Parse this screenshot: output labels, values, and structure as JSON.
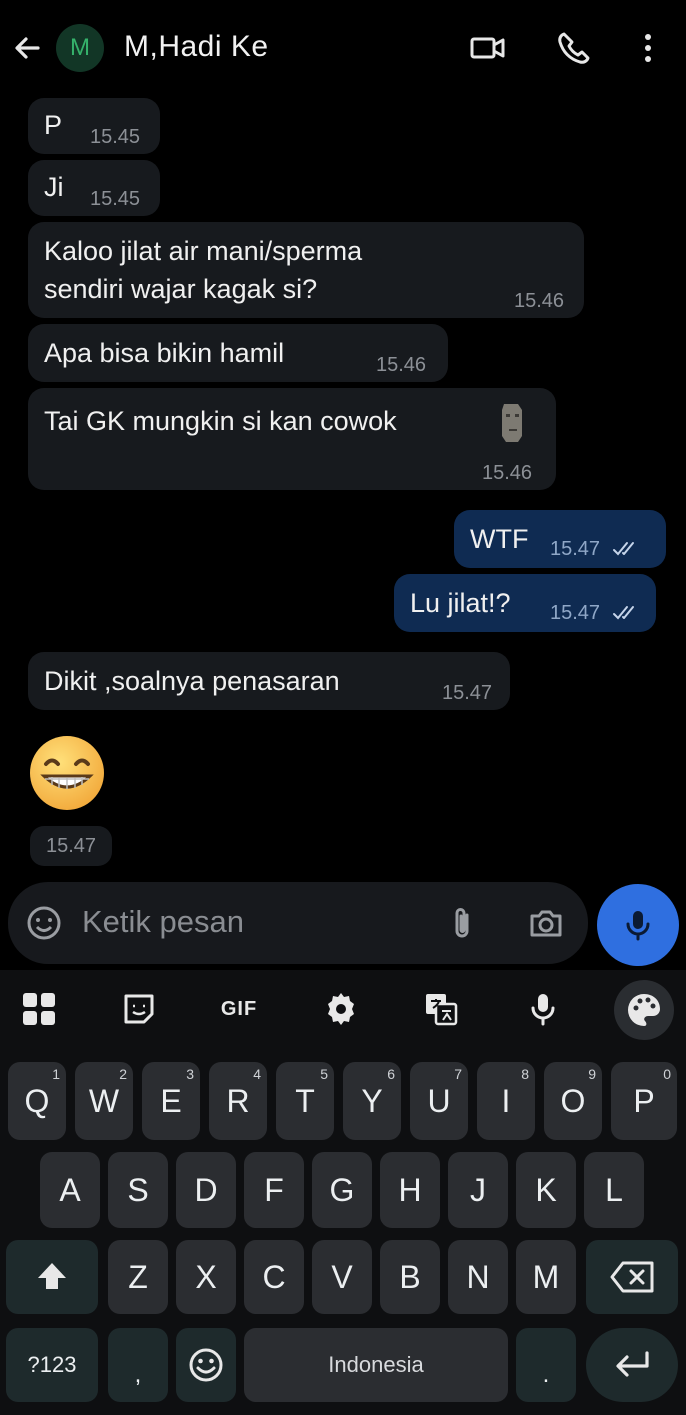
{
  "header": {
    "contact_initial": "M",
    "contact_name": "M,Hadi Ke"
  },
  "messages": [
    {
      "text": "P",
      "time": "15.45"
    },
    {
      "text": "Ji",
      "time": "15.45"
    },
    {
      "text": "Kaloo jilat air mani/sperma\nsendiri wajar kagak si?",
      "time": "15.46"
    },
    {
      "text": "Apa bisa bikin hamil",
      "time": "15.46"
    },
    {
      "text": "Tai GK mungkin si kan cowok",
      "time": "15.46"
    },
    {
      "text": "WTF",
      "time": "15.47"
    },
    {
      "text": "Lu jilat!?",
      "time": "15.47"
    },
    {
      "text": "Dikit ,soalnya penasaran",
      "time": "15.47"
    },
    {
      "time": "15.47"
    }
  ],
  "composer": {
    "placeholder": "Ketik pesan"
  },
  "keyboard": {
    "toolbar": {
      "gif_label": "GIF"
    },
    "row1": [
      {
        "key": "Q",
        "hint": "1"
      },
      {
        "key": "W",
        "hint": "2"
      },
      {
        "key": "E",
        "hint": "3"
      },
      {
        "key": "R",
        "hint": "4"
      },
      {
        "key": "T",
        "hint": "5"
      },
      {
        "key": "Y",
        "hint": "6"
      },
      {
        "key": "U",
        "hint": "7"
      },
      {
        "key": "I",
        "hint": "8"
      },
      {
        "key": "O",
        "hint": "9"
      },
      {
        "key": "P",
        "hint": "0"
      }
    ],
    "row2": [
      "A",
      "S",
      "D",
      "F",
      "G",
      "H",
      "J",
      "K",
      "L"
    ],
    "row3": [
      "Z",
      "X",
      "C",
      "V",
      "B",
      "N",
      "M"
    ],
    "symbols_label": "?123",
    "comma": ",",
    "space_label": "Indonesia",
    "period": "."
  },
  "colors": {
    "incoming_bubble": "#171a1e",
    "outgoing_bubble": "#0f2b52",
    "accent_blue": "#2f6fe0",
    "avatar_green": "#35b26b"
  }
}
